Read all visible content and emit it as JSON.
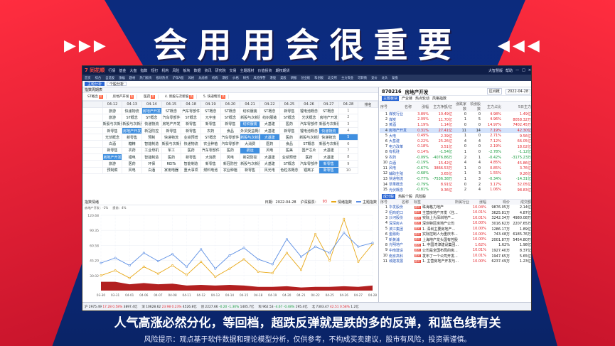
{
  "headline": "会用用会很重要",
  "caption": "人气高涨必然分化，等回档，超跌反弹就是跌的多的反弹，和蓝色线有关",
  "risk": "风险提示：观点基于软件数据和理论模型分析，仅供参考，不构成买卖建议，股市有风险，投资需谨慎。",
  "app": {
    "logo": "7 同花顺",
    "menus": [
      "行情",
      "基金",
      "大盘",
      "指数",
      "短打",
      "机构",
      "风险",
      "板块",
      "数据",
      "资讯",
      "研究院",
      "交易",
      "主题题材",
      "价值投资",
      "期权期货"
    ],
    "right": [
      "大智慧版",
      "帮助",
      "—",
      "□",
      "×"
    ],
    "nav": [
      "首页",
      "综合",
      "自选股",
      "涨幅",
      "题材",
      "热门板块",
      "板块热点",
      "沪深A股",
      "风格",
      "龙虎榜",
      "机构",
      "期权",
      "价格",
      "财务",
      "风险预警",
      "港股",
      "美股",
      "研报",
      "创业板",
      "科创板",
      "北交所",
      "主力资金",
      "可转债",
      "竞价",
      "龙头",
      "复盘"
    ],
    "subtabs": [
      "主题分析",
      "个股分析"
    ]
  },
  "theme": {
    "title": "指数周期表",
    "pins": [
      {
        "name": "ST概念",
        "badge": "热"
      },
      {
        "name": "房地产开发",
        "badge": "热"
      },
      {
        "name": "医药",
        "badge": "热"
      },
      {
        "name": "4. 新股与次新股",
        "badge": "热"
      },
      {
        "name": "5. 快递物流",
        "badge": "热"
      }
    ],
    "headers": [
      "",
      "04-12",
      "04-13",
      "04-14",
      "04-15",
      "04-18",
      "04-19",
      "04-20",
      "04-21",
      "04-22",
      "04-25",
      "04-26",
      "04-27",
      "04-28",
      "排名"
    ],
    "rows": [
      [
        "旅游",
        "快递物流",
        "房地产开发",
        "ST概念",
        "汽车零部件",
        "ST概念",
        "ST概念",
        "纺织服装",
        "ST概念",
        "新零售",
        "锂电池概念",
        "ST概念",
        "1"
      ],
      [
        "旅游",
        "ST概念",
        "ST概念",
        "汽车零部件",
        "ST概念",
        "元宇宙",
        "ST概念",
        "新股与次新股",
        "纺织服装",
        "ST概念",
        "光伏概念",
        "房地产开发",
        "2"
      ],
      [
        "新股与次新股",
        "新股与次新股",
        "快递物流",
        "房地产开发",
        "新零售",
        "新零售",
        "新零售",
        "纺织服装",
        "大基建",
        "医药",
        "汽车零部件",
        "新股与次新股",
        "3"
      ],
      [
        "新零售",
        "房地产开发",
        "新冠防控",
        "新零售",
        "新零售",
        "农药",
        "食品",
        "外贸受益概念",
        "大基建",
        "新零售",
        "锂电池概念",
        "快递物流",
        "4"
      ],
      [
        "光伏概念",
        "新零售",
        "预制",
        "快递物流",
        "业绩预增",
        "ST概念",
        "汽车零部件",
        "新股与次新股",
        "大基建",
        "医药",
        "新股与次新股",
        "快递物流",
        "5"
      ],
      [
        "白酒",
        "糖精",
        "智能制造",
        "新股与次新股",
        "快递物流",
        "农业种植",
        "汽车零部件",
        "大消费",
        "医药",
        "食品",
        "ST概念",
        "新股与次新股",
        "6"
      ],
      [
        "新零售",
        "农药",
        "工业母机",
        "军工",
        "医药",
        "汽车零部件",
        "医药",
        "航运",
        "风电",
        "医美",
        "国产芯片",
        "大基建",
        "7"
      ],
      [
        "房地产开发",
        "锂电",
        "智能制造",
        "医药",
        "新零售",
        "大消费",
        "风电",
        "新冠防控",
        "大基建",
        "业绩预增",
        "医药",
        "大基建",
        "8"
      ],
      [
        "旅游",
        "医药",
        "环保",
        "REITs",
        "智能制造",
        "新零售",
        "新冠防控",
        "新股与次新股",
        "大基建",
        "ST概念",
        "汽车零部件",
        "新零售",
        "9"
      ],
      [
        "预制菜",
        "风电",
        "白酒",
        "家用电器",
        "重大事项",
        "燃料电池",
        "农业种植",
        "新零售",
        "风光电",
        "色粒浓概念",
        "锂离子",
        "新零售",
        "10"
      ]
    ]
  },
  "chart": {
    "title": "指数情绪",
    "date": "日期：2022-04-28",
    "info_label": "沪深股票：",
    "info_value": "93",
    "legend": [
      "情绪指数",
      "主题指数"
    ],
    "stats": [
      "房地产开发：-1%",
      "提前：4%"
    ]
  },
  "chart_data": {
    "type": "line",
    "x": [
      "03-30",
      "03-31",
      "04-01",
      "04-06",
      "04-07",
      "04-08",
      "04-11",
      "04-12",
      "04-13",
      "04-14",
      "04-15",
      "04-18",
      "04-19",
      "04-20",
      "04-21",
      "04-22",
      "04-25",
      "04-26",
      "04-27",
      "04-28"
    ],
    "ylabels": [
      "120.68",
      "90.35",
      "60.58",
      "45.20",
      "30.02"
    ],
    "series": [
      {
        "name": "情绪指数",
        "values": [
          24,
          32,
          20,
          38,
          27,
          40,
          25,
          46,
          22,
          35,
          50,
          30,
          28,
          60,
          33,
          90,
          48,
          114,
          46,
          74
        ],
        "color": "#e8a817"
      },
      {
        "name": "主题指数",
        "values": [
          44,
          52,
          40,
          60,
          47,
          58,
          38,
          66,
          35,
          56,
          68,
          50,
          42,
          82,
          54,
          70,
          60,
          92,
          70,
          76
        ],
        "color": "#5a8de3"
      }
    ],
    "area": {
      "name": "热度",
      "values": [
        14,
        14,
        10,
        12,
        10,
        11,
        8,
        9,
        8,
        9,
        8,
        6,
        6,
        7,
        5,
        6,
        6,
        7,
        6,
        8
      ],
      "color": "#b22020"
    }
  },
  "right": {
    "code": "870216",
    "name": "房地产开发",
    "range_label": "区间概",
    "date": "2022-04-28",
    "tabs": [
      "主题板块",
      "产业链",
      "热点轮动",
      "风格指数"
    ],
    "cols": [
      "序号",
      "名称",
      "涨幅",
      "主力净额/亿",
      "涨跌家数",
      "领涨股数",
      "主力占比",
      "5日主力"
    ],
    "rows": [
      [
        "1",
        "煤炭行业",
        "3.89%",
        "10.49亿",
        "0",
        "0",
        "4.98%",
        "1.49亿"
      ],
      [
        "2",
        "煤炭",
        "2.09%",
        "11.70亿",
        "1",
        "5",
        "4.96%",
        "8058.32万"
      ],
      [
        "3",
        "黄酒",
        "1.19%",
        "1.14亿",
        "0",
        "0",
        "14.97%",
        "7402.45万"
      ],
      [
        "4",
        "房地产开发",
        "0.31%",
        "27.41亿",
        "11",
        "14",
        "7.19%",
        "42.30亿"
      ],
      [
        "5",
        "大电",
        "0.49%",
        "2.39亿",
        "1",
        "0",
        "2.71%",
        "9.56亿"
      ],
      [
        "6",
        "大基建",
        "0.22%",
        "25.26亿",
        "4",
        "4",
        "7.12%",
        "66.05亿"
      ],
      [
        "7",
        "电力改革",
        "0.18%",
        "3.51亿",
        "0",
        "0",
        "2.19%",
        "18.02亿"
      ],
      [
        "8",
        "有机硅",
        "0.14%",
        "-1.54亿",
        "1",
        "0",
        "-2.78%",
        "-1.12亿"
      ],
      [
        "9",
        "农药",
        "-0.09%",
        "-4076.86万",
        "2",
        "1",
        "-0.42%",
        "-3175.23万"
      ],
      [
        "10",
        "白酒",
        "-0.19%",
        "15.42亿",
        "4",
        "4",
        "4.85%",
        "45.86亿"
      ],
      [
        "11",
        "风电",
        "-0.67%",
        "3866.53万",
        "1",
        "0",
        "0.85%",
        "3.76亿"
      ],
      [
        "12",
        "辅助生殖",
        "-0.68%",
        "3.65亿",
        "1",
        "3",
        "1.55%",
        "9.26亿"
      ],
      [
        "13",
        "快递物流",
        "-0.77%",
        "-7536.38万",
        "1",
        "3",
        "-0.34%",
        "-14.31亿"
      ],
      [
        "14",
        "草果概念",
        "-0.79%",
        "8.91亿",
        "0",
        "2",
        "3.17%",
        "32.05亿"
      ],
      [
        "15",
        "光伏概念",
        "-0.81%",
        "9.36亿",
        "2",
        "4",
        "1.06%",
        "98.83亿"
      ]
    ],
    "stock_tabs": [
      "成分股",
      "热股个股",
      "风险股"
    ],
    "stock_cols": [
      "序号",
      "名称",
      "标签",
      "所属行业",
      "涨幅",
      "现价",
      "成交额"
    ],
    "stocks": [
      [
        "1",
        "华发股份",
        "题材",
        "珠海格力地产",
        "10.04%",
        "9876.05万",
        "2.14亿"
      ],
      [
        "2",
        "招商蛇口",
        "题材",
        "主营房地产开发（住...",
        "10.01%",
        "3625.81万",
        "4.87亿"
      ],
      [
        "3",
        "沙河股份",
        "题材",
        "实际上为深圳地产...",
        "10.01%",
        "3242.34万",
        "4980.08万"
      ],
      [
        "4",
        "深深房Ａ",
        "题材",
        "深圳特区房地产公司",
        "10.00%",
        "3016.62万",
        "2207.65万"
      ],
      [
        "5",
        "滨江集团",
        "题材",
        "1. 深圳主要房地产...",
        "10.00%",
        "1286.17万",
        "1.89亿"
      ],
      [
        "6",
        "金融街",
        "题材",
        "实际控制人为重庆市...",
        "10.00%",
        "743.48万",
        "6185.76万"
      ],
      [
        "7",
        "新黄浦",
        "题材",
        "上海地产龙头国有控股",
        "10.00%",
        "2001.87万",
        "5454.80万"
      ],
      [
        "8",
        "光明地产",
        "题材",
        "1. 中国湾漳建设集团...",
        "1.62%",
        "1.62%",
        "1.98亿"
      ],
      [
        "9",
        "中南建设",
        "题材",
        "公司是全国布局的房...",
        "10.01%",
        "1927.40万",
        "8.37亿"
      ],
      [
        "10",
        "南京高科",
        "题材",
        "发布了一个公司开发...",
        "10.01%",
        "1947.65万",
        "5.65亿"
      ],
      [
        "11",
        "城建发展",
        "题材",
        "1. 主营房地产开发与...",
        "10.00%",
        "6237.49万",
        "1.23亿"
      ]
    ]
  },
  "status": [
    {
      "label": "沪 2975.49",
      "val": "17.28 0.58%",
      "amt": "3897.4亿"
    },
    {
      "label": "深 10628.62",
      "val": "23.98 0.23%",
      "amt": "4526.8亿"
    },
    {
      "label": "创 2227.66",
      "val": "-0.20 -1.30%",
      "amt": "1405.7亿"
    },
    {
      "label": "科 962.53",
      "val": "-4.67 -0.48%",
      "amt": "195.4亿"
    },
    {
      "label": "北 7303.47",
      "val": "42.51 0.58%",
      "amt": "1.2亿"
    }
  ]
}
